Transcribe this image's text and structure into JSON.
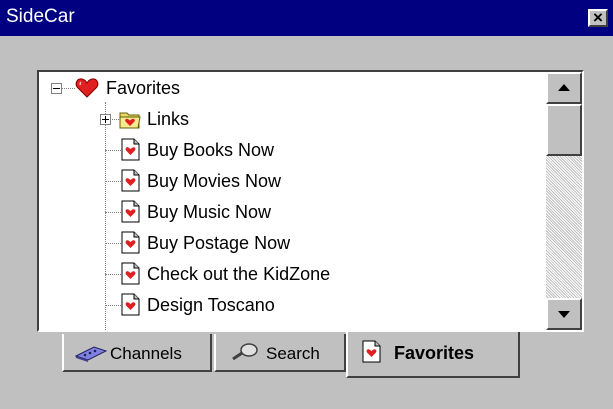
{
  "window": {
    "title": "SideCar",
    "close_glyph": "×"
  },
  "tree": {
    "root": {
      "label": "Favorites",
      "icon": "heart-icon",
      "expanded": true
    },
    "items": [
      {
        "label": "Links",
        "icon": "folder-heart-icon",
        "collapsed": true
      },
      {
        "label": "Buy Books Now",
        "icon": "page-heart-icon"
      },
      {
        "label": "Buy Movies Now",
        "icon": "page-heart-icon"
      },
      {
        "label": "Buy Music Now",
        "icon": "page-heart-icon"
      },
      {
        "label": "Buy Postage Now",
        "icon": "page-heart-icon"
      },
      {
        "label": "Check out the KidZone",
        "icon": "page-heart-icon"
      },
      {
        "label": "Design Toscano",
        "icon": "page-heart-icon"
      }
    ]
  },
  "tabs": [
    {
      "label": "Channels",
      "icon": "channels-icon",
      "active": false
    },
    {
      "label": "Search",
      "icon": "magnifier-icon",
      "active": false
    },
    {
      "label": "Favorites",
      "icon": "page-heart-icon",
      "active": true
    }
  ],
  "colors": {
    "titlebar": "#000080",
    "face": "#c0c0c0",
    "heart": "#d80000"
  }
}
